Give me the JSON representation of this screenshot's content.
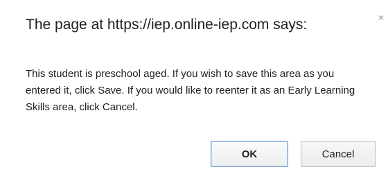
{
  "dialog": {
    "title": "The page at https://iep.online-iep.com says:",
    "close_glyph": "×",
    "message": "This student is preschool aged. If you wish to save this area as you entered it, click Save. If you would like to reenter it as an Early Learning Skills area, click Cancel.",
    "buttons": {
      "ok_label": "OK",
      "cancel_label": "Cancel"
    }
  }
}
